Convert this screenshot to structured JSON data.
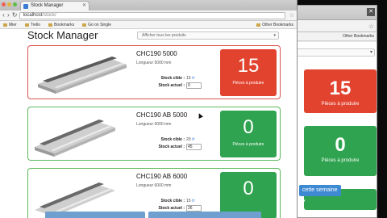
{
  "browser": {
    "tab_title": "Stock Manager",
    "url_host": "localhost",
    "url_path": "/stock/",
    "bookmarks": [
      "Mier",
      "Trello",
      "Bookmarks",
      "Go on Single"
    ],
    "bookmarks_right": "Other Bookmarks"
  },
  "app": {
    "title": "Stock Manager",
    "filter_placeholder": "Afficher tous les produits"
  },
  "products": [
    {
      "name": "CHC190 5000",
      "length": "Longueur 5000 mm",
      "stock_cible_label": "Stock cible :",
      "stock_cible": "15",
      "stock_actuel_label": "Stock actuel :",
      "stock_actuel": "0",
      "pieces": "15",
      "pieces_label": "Pièces à produire",
      "status": "red"
    },
    {
      "name": "CHC190 AB 5000",
      "length": "Longueur 5000 mm",
      "stock_cible_label": "Stock cible :",
      "stock_cible": "20",
      "stock_actuel_label": "Stock actuel :",
      "stock_actuel": "45",
      "pieces": "0",
      "pieces_label": "Pièces à produire",
      "status": "green"
    },
    {
      "name": "CHC190 AB 6000",
      "length": "Longueur 6000 mm",
      "stock_cible_label": "Stock cible :",
      "stock_cible": "15",
      "stock_actuel_label": "Stock actuel :",
      "stock_actuel": "26",
      "pieces": "0",
      "pieces_label": "",
      "status": "green"
    }
  ],
  "bg_window": {
    "bookmarks_right": "Other Bookmarks",
    "cards": [
      {
        "pieces": "15",
        "pieces_label": "Pièces à produire",
        "color": "#e2432f"
      },
      {
        "pieces": "0",
        "pieces_label": "Pièces à produire",
        "color": "#2fa34f"
      }
    ],
    "dropdown_label": "cette semaine ▾"
  },
  "colors": {
    "red": "#e2432f",
    "green": "#2fa34f",
    "primary": "#3d8ad3"
  }
}
